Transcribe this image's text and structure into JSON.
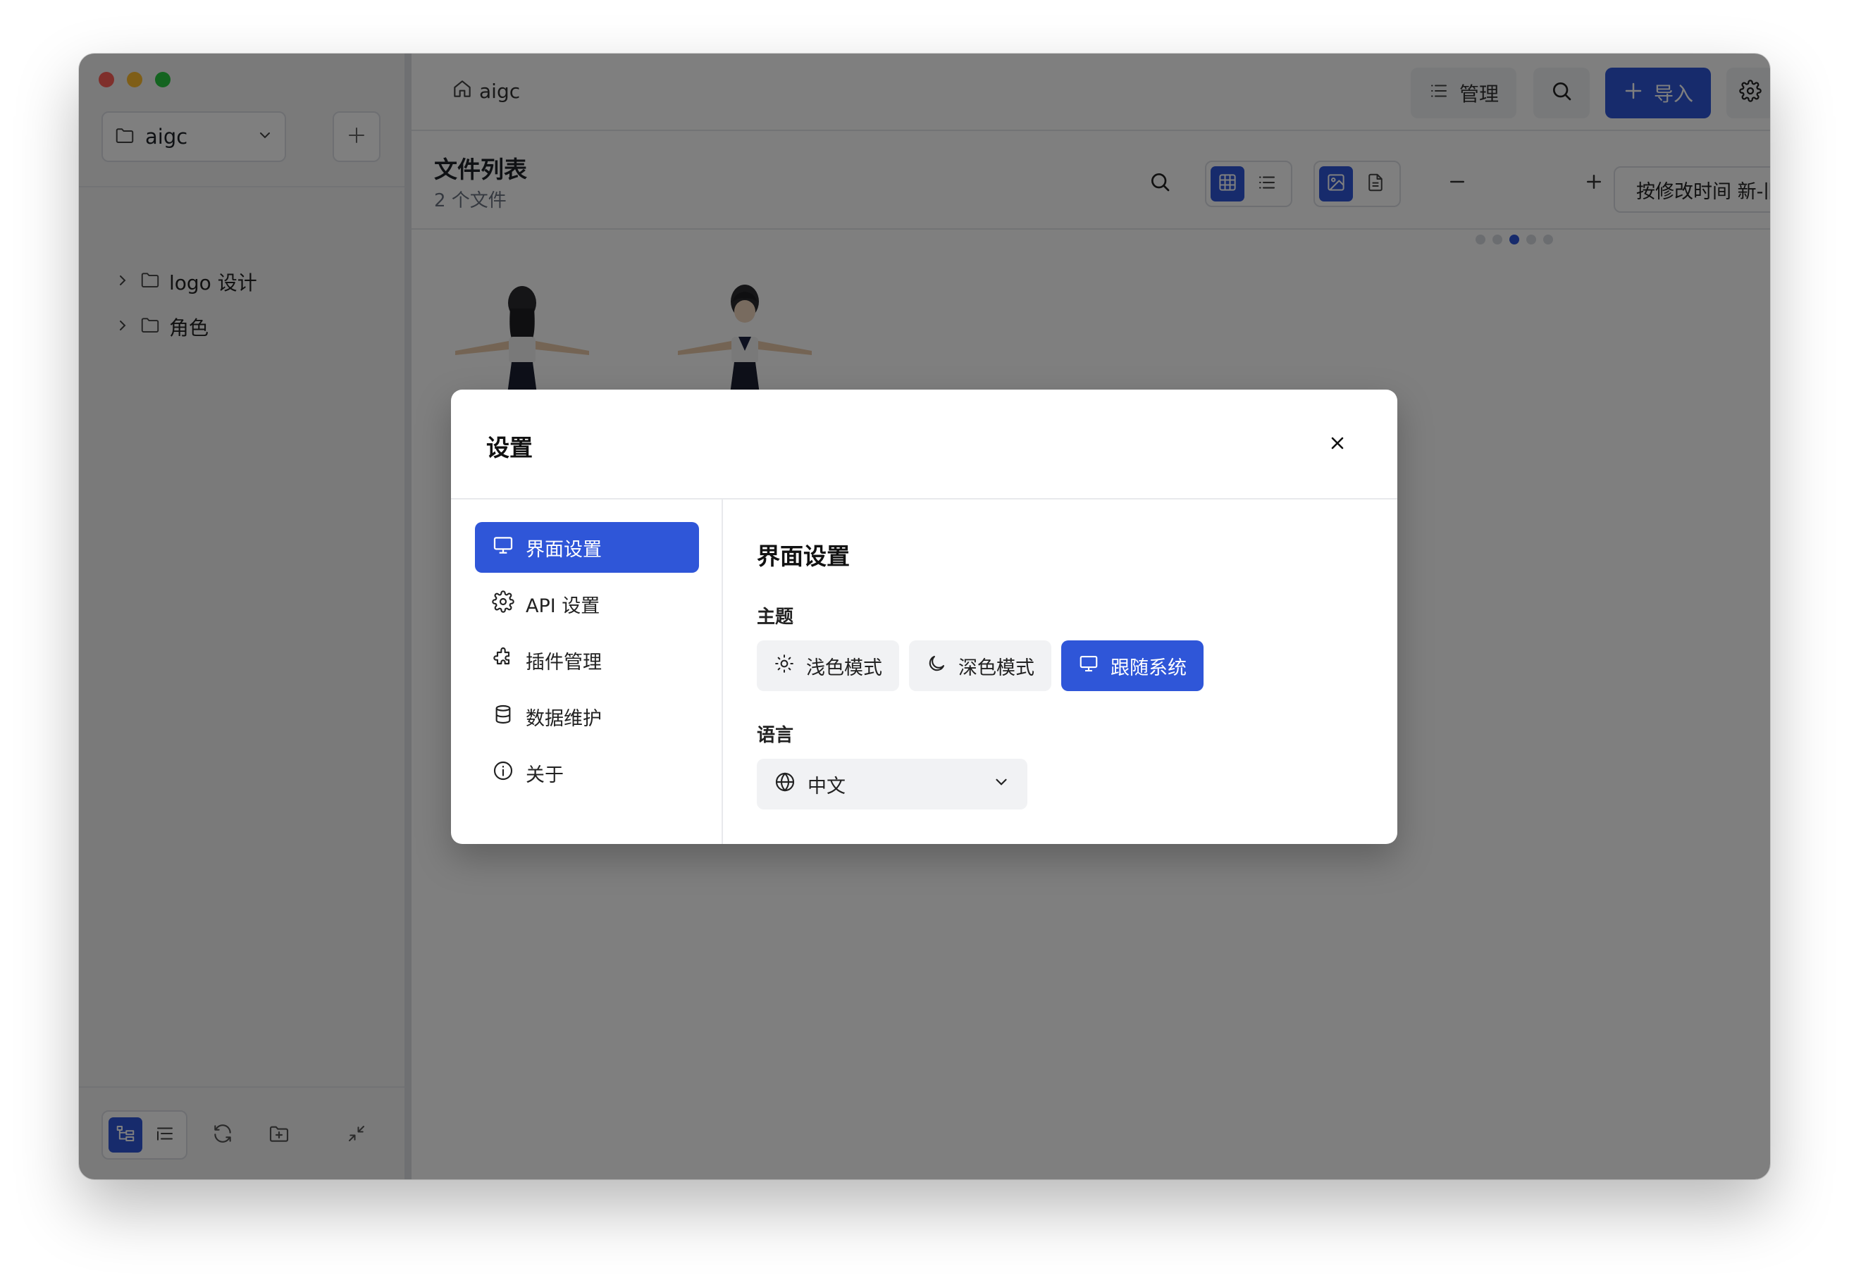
{
  "window": {
    "breadcrumb": "aigc"
  },
  "sidebar": {
    "library": "aigc",
    "tree": [
      {
        "label": "logo 设计"
      },
      {
        "label": "角色"
      }
    ]
  },
  "toolbar": {
    "manage_label": "管理",
    "import_label": "导入"
  },
  "file_list": {
    "title": "文件列表",
    "count": "2 个文件",
    "sort_label": "按修改时间 新-旧"
  },
  "settings": {
    "title": "设置",
    "nav": [
      {
        "label": "界面设置",
        "icon": "monitor-icon",
        "active": true
      },
      {
        "label": "API 设置",
        "icon": "gear-icon"
      },
      {
        "label": "插件管理",
        "icon": "puzzle-icon"
      },
      {
        "label": "数据维护",
        "icon": "database-icon"
      },
      {
        "label": "关于",
        "icon": "info-icon"
      }
    ],
    "section_title": "界面设置",
    "theme": {
      "label": "主题",
      "options": [
        {
          "label": "浅色模式",
          "icon": "sun-icon"
        },
        {
          "label": "深色模式",
          "icon": "moon-icon"
        },
        {
          "label": "跟随系统",
          "icon": "monitor-icon",
          "selected": true
        }
      ]
    },
    "language": {
      "label": "语言",
      "value": "中文"
    }
  },
  "colors": {
    "accent": "#2f56d8",
    "overlay": "rgba(0,0,0,0.5)"
  }
}
